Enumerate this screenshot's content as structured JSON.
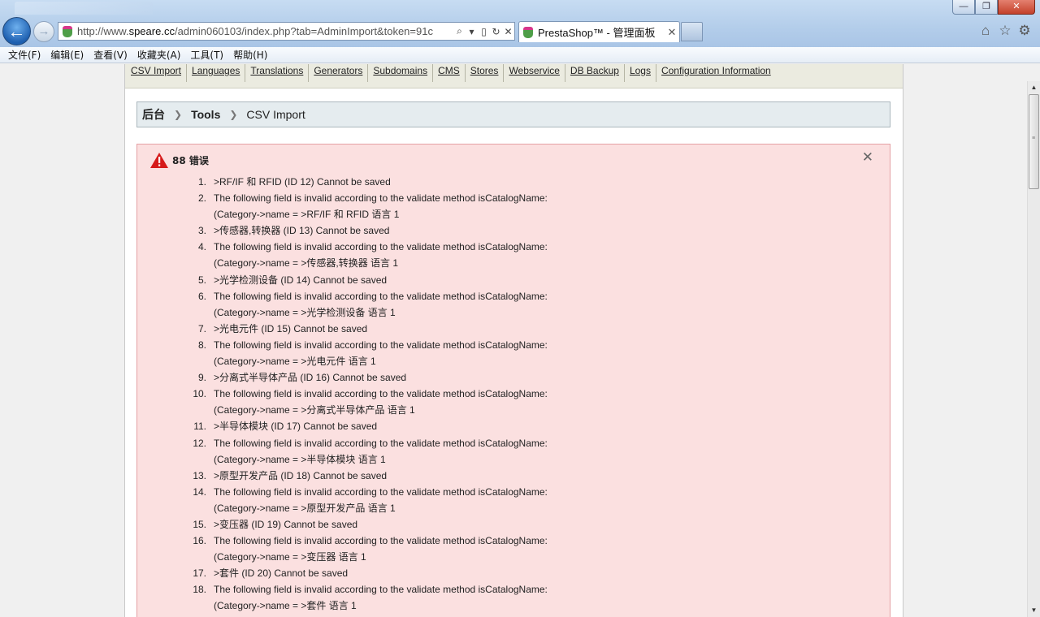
{
  "browser": {
    "url_prefix": "http://www.",
    "url_domain": "speare.cc",
    "url_rest": "/admin060103/index.php?tab=AdminImport&token=91c",
    "tab_title": "PrestaShop™ - 管理面板",
    "window_buttons": {
      "minimize": "—",
      "restore": "❐",
      "close": "✕"
    },
    "menu": [
      "文件(F)",
      "编辑(E)",
      "查看(V)",
      "收藏夹(A)",
      "工具(T)",
      "帮助(H)"
    ]
  },
  "subnav": [
    "CSV Import",
    "Languages",
    "Translations",
    "Generators",
    "Subdomains",
    "CMS",
    "Stores",
    "Webservice",
    "DB Backup",
    "Logs",
    "Configuration Information"
  ],
  "breadcrumb": {
    "home": "后台",
    "section": "Tools",
    "current": "CSV Import"
  },
  "errors": {
    "title": "88 错误",
    "close": "✕",
    "items": [
      {
        "num": "1.",
        "text": ">RF/IF 和 RFID (ID 12) Cannot be saved"
      },
      {
        "num": "2.",
        "text": "The following field is invalid according to the validate method isCatalogName:\n(Category->name = >RF/IF 和 RFID 语言 1"
      },
      {
        "num": "3.",
        "text": ">传感器,转换器 (ID 13) Cannot be saved"
      },
      {
        "num": "4.",
        "text": "The following field is invalid according to the validate method isCatalogName:\n(Category->name = >传感器,转换器 语言 1"
      },
      {
        "num": "5.",
        "text": ">光学检测设备 (ID 14) Cannot be saved"
      },
      {
        "num": "6.",
        "text": "The following field is invalid according to the validate method isCatalogName:\n(Category->name = >光学检测设备 语言 1"
      },
      {
        "num": "7.",
        "text": ">光电元件 (ID 15) Cannot be saved"
      },
      {
        "num": "8.",
        "text": "The following field is invalid according to the validate method isCatalogName:\n(Category->name = >光电元件 语言 1"
      },
      {
        "num": "9.",
        "text": ">分离式半导体产品 (ID 16) Cannot be saved"
      },
      {
        "num": "10.",
        "text": "The following field is invalid according to the validate method isCatalogName:\n(Category->name = >分离式半导体产品 语言 1"
      },
      {
        "num": "11.",
        "text": ">半导体模块 (ID 17) Cannot be saved"
      },
      {
        "num": "12.",
        "text": "The following field is invalid according to the validate method isCatalogName:\n(Category->name = >半导体模块 语言 1"
      },
      {
        "num": "13.",
        "text": ">原型开发产品 (ID 18) Cannot be saved"
      },
      {
        "num": "14.",
        "text": "The following field is invalid according to the validate method isCatalogName:\n(Category->name = >原型开发产品 语言 1"
      },
      {
        "num": "15.",
        "text": ">变压器 (ID 19) Cannot be saved"
      },
      {
        "num": "16.",
        "text": "The following field is invalid according to the validate method isCatalogName:\n(Category->name = >变压器 语言 1"
      },
      {
        "num": "17.",
        "text": ">套件 (ID 20) Cannot be saved"
      },
      {
        "num": "18.",
        "text": "The following field is invalid according to the validate method isCatalogName:\n(Category->name = >套件 语言 1"
      }
    ]
  },
  "colors": {
    "error_bg": "#fbe0e0",
    "error_border": "#e4a1a5",
    "breadcrumb_bg": "#e5ecef",
    "subnav_bg": "#ebebe0"
  }
}
